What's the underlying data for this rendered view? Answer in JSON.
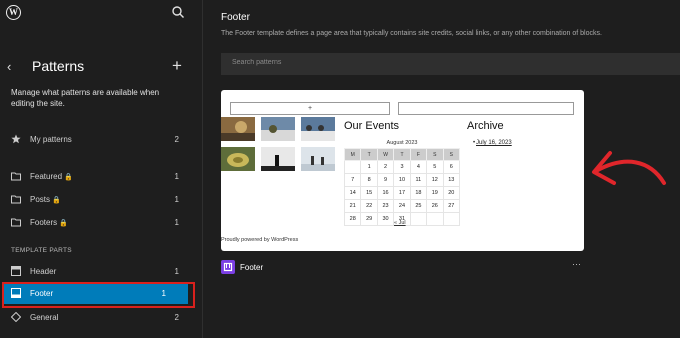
{
  "sidebar": {
    "title": "Patterns",
    "back_icon": "chevron-left-icon",
    "add_icon": "plus-icon",
    "description": "Manage what patterns are available when editing the site.",
    "my_patterns": {
      "label": "My patterns",
      "count": "2"
    },
    "categories": [
      {
        "label": "Featured",
        "count": "1",
        "locked": true
      },
      {
        "label": "Posts",
        "count": "1",
        "locked": true
      },
      {
        "label": "Footers",
        "count": "1",
        "locked": true
      }
    ],
    "section_label": "TEMPLATE PARTS",
    "template_parts": [
      {
        "label": "Header",
        "count": "1"
      },
      {
        "label": "Footer",
        "count": "1",
        "active": true
      },
      {
        "label": "General",
        "count": "2"
      }
    ],
    "active_color": "#007cba",
    "highlight_color": "#d9211d"
  },
  "main": {
    "title": "Footer",
    "description": "The Footer template defines a page area that typically contains site credits, social links, or any other combination of blocks.",
    "search": {
      "placeholder": "Search patterns"
    },
    "preview": {
      "search_button": "+",
      "events_title": "Our Events",
      "archive_title": "Archive",
      "archive_link": "July 16, 2023",
      "calendar": {
        "caption": "August 2023",
        "days": [
          "M",
          "T",
          "W",
          "T",
          "F",
          "S",
          "S"
        ],
        "rows": [
          [
            "",
            "1",
            "2",
            "3",
            "4",
            "5",
            "6"
          ],
          [
            "7",
            "8",
            "9",
            "10",
            "11",
            "12",
            "13"
          ],
          [
            "14",
            "15",
            "16",
            "17",
            "18",
            "19",
            "20"
          ],
          [
            "21",
            "22",
            "23",
            "24",
            "25",
            "26",
            "27"
          ],
          [
            "28",
            "29",
            "30",
            "31",
            "",
            "",
            ""
          ]
        ],
        "prev_link": "« Jul"
      },
      "powered_by": "Proudly powered by WordPress"
    },
    "pattern_name": "Footer",
    "more_icon": "ellipsis-icon",
    "annotation_color": "#e0262b"
  }
}
